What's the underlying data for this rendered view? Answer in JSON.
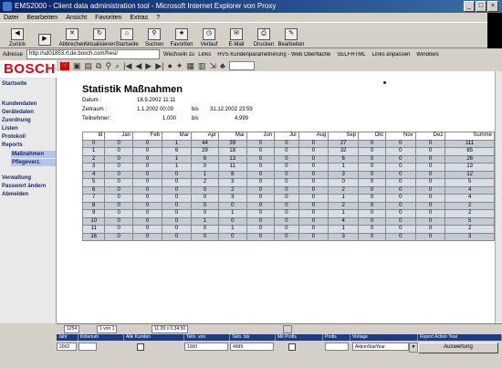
{
  "window": {
    "title": "EMS2000 - Client data administration tool - Microsoft Internet Explorer von Proxy"
  },
  "menu": [
    "Datei",
    "Bearbeiten",
    "Ansicht",
    "Favoriten",
    "Extras",
    "?"
  ],
  "toolbar": [
    {
      "label": "Zurück",
      "icon": "back-icon"
    },
    {
      "label": "",
      "icon": "forward-icon"
    },
    {
      "label": "Abbrechen",
      "icon": "stop-icon"
    },
    {
      "label": "Aktualisieren",
      "icon": "refresh-icon"
    },
    {
      "label": "Startseite",
      "icon": "home-icon"
    },
    {
      "label": "Suchen",
      "icon": "search-icon"
    },
    {
      "label": "Favoriten",
      "icon": "favorites-icon"
    },
    {
      "label": "Verlauf",
      "icon": "history-icon"
    },
    {
      "label": "E-Mail",
      "icon": "mail-icon"
    },
    {
      "label": "Drucken",
      "icon": "print-icon"
    },
    {
      "label": "Bearbeiten",
      "icon": "edit-icon"
    }
  ],
  "address": {
    "label": "Adresse",
    "value": "http://sd01853.rt.de.bosch.com/fresi/",
    "go": "Wechseln zu",
    "links": [
      "Links",
      "HVS Kundenparametrierung - Web Oberfläche",
      "SELFHTML",
      "Links anpassen",
      "Windows"
    ]
  },
  "brand": "BOSCH",
  "sidebar": {
    "items": [
      {
        "label": "Startseite"
      },
      {
        "label": "Kundendaten"
      },
      {
        "label": "Geräte­daten"
      },
      {
        "label": "Zuordnung"
      },
      {
        "label": "Listen"
      },
      {
        "label": "Protokoll"
      },
      {
        "label": "Reports"
      },
      {
        "label": "Verwaltung"
      },
      {
        "label": "Passwort ändern"
      },
      {
        "label": "Abmelden"
      }
    ],
    "subitems": [
      {
        "label": "Maßnahmen"
      },
      {
        "label": "Pflegeverz."
      }
    ]
  },
  "report": {
    "title": "Statistik Maßnahmen",
    "datum_label": "Datum :",
    "datum_value": "18.9.2002 11:11",
    "zeitraum_label": "Zeitraum :",
    "zeitraum_from": "1.1.2002 00:00",
    "zeitraum_bis": "bis",
    "zeitraum_to": "31.12.2002 23:59",
    "teilnehmer_label": "Teilnehmer:",
    "teilnehmer_from": "1.000",
    "teilnehmer_bis": "bis",
    "teilnehmer_to": "4.999"
  },
  "table": {
    "headers": [
      "Id",
      "Jan",
      "Feb",
      "Mar",
      "Apr",
      "Mai",
      "Jun",
      "Jul",
      "Aug",
      "Sep",
      "Okt",
      "Nov",
      "Dez",
      "Summe"
    ],
    "rows": [
      [
        "0",
        "0",
        "0",
        "1",
        "44",
        "39",
        "0",
        "0",
        "0",
        "27",
        "0",
        "0",
        "0",
        "111"
      ],
      [
        "1",
        "0",
        "0",
        "6",
        "29",
        "18",
        "0",
        "0",
        "0",
        "32",
        "0",
        "0",
        "0",
        "85"
      ],
      [
        "2",
        "0",
        "0",
        "1",
        "6",
        "13",
        "0",
        "0",
        "0",
        "6",
        "0",
        "0",
        "0",
        "26"
      ],
      [
        "3",
        "0",
        "0",
        "1",
        "0",
        "11",
        "0",
        "0",
        "0",
        "1",
        "0",
        "0",
        "0",
        "13"
      ],
      [
        "4",
        "0",
        "0",
        "0",
        "1",
        "8",
        "0",
        "0",
        "0",
        "3",
        "0",
        "0",
        "0",
        "12"
      ],
      [
        "5",
        "0",
        "0",
        "0",
        "2",
        "3",
        "0",
        "0",
        "0",
        "0",
        "0",
        "0",
        "0",
        "5"
      ],
      [
        "6",
        "0",
        "0",
        "0",
        "0",
        "2",
        "0",
        "0",
        "0",
        "2",
        "0",
        "0",
        "0",
        "4"
      ],
      [
        "7",
        "0",
        "0",
        "0",
        "0",
        "3",
        "0",
        "0",
        "0",
        "1",
        "0",
        "0",
        "0",
        "4"
      ],
      [
        "8",
        "0",
        "0",
        "0",
        "0",
        "0",
        "0",
        "0",
        "0",
        "2",
        "0",
        "0",
        "0",
        "2"
      ],
      [
        "9",
        "0",
        "0",
        "0",
        "0",
        "1",
        "0",
        "0",
        "0",
        "1",
        "0",
        "0",
        "0",
        "2"
      ],
      [
        "10",
        "0",
        "0",
        "0",
        "1",
        "0",
        "0",
        "0",
        "0",
        "4",
        "0",
        "0",
        "0",
        "5"
      ],
      [
        "11",
        "0",
        "0",
        "0",
        "0",
        "1",
        "0",
        "0",
        "0",
        "1",
        "0",
        "0",
        "0",
        "2"
      ],
      [
        "16",
        "0",
        "0",
        "0",
        "0",
        "0",
        "0",
        "0",
        "0",
        "3",
        "0",
        "0",
        "0",
        "3"
      ]
    ]
  },
  "bottom_tabs": [
    "1254",
    "1 von 1",
    "11.09 s 0.34.50"
  ],
  "filter": {
    "headers": [
      "Jahr",
      "Kriterium",
      "Alle Kunden",
      "Teiln. von",
      "Teiln. bis",
      "Mit Profis",
      "Profis",
      "Vorlage",
      "Report Action Year"
    ],
    "values": {
      "jahr": "2002",
      "teiln_von": "1000",
      "teiln_bis": "4999",
      "vorlage": "AktionStatYear",
      "button": "Auswertung"
    }
  }
}
